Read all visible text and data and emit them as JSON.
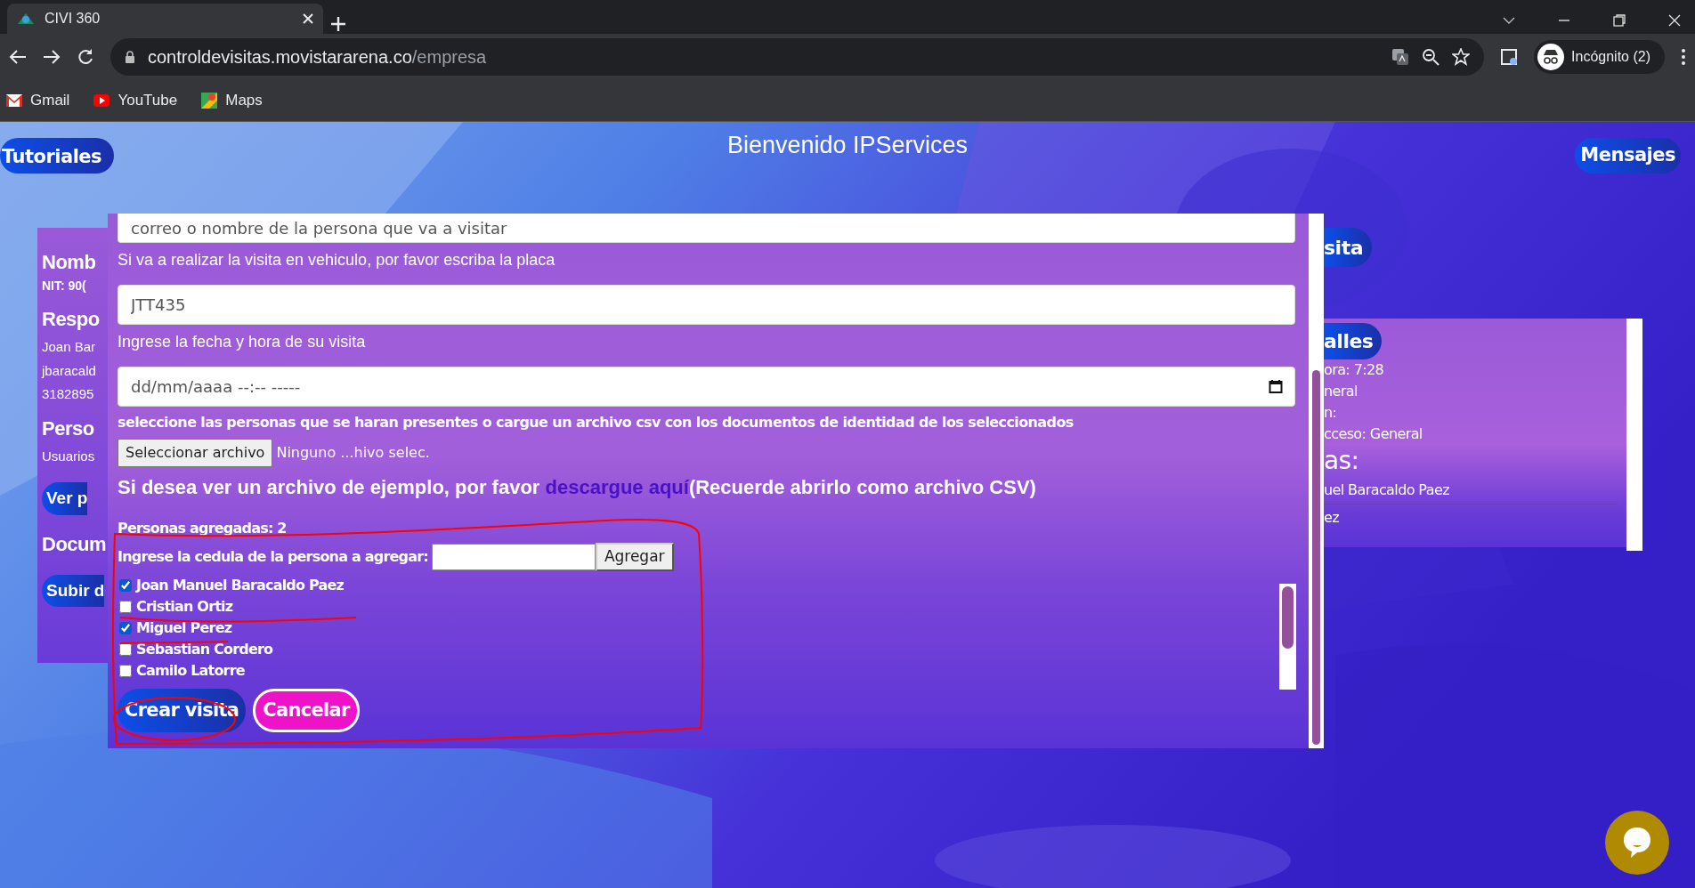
{
  "browser": {
    "tab_title": "CIVI 360",
    "url_host": "controldevisitas.movistararena.co",
    "url_path": "/empresa",
    "profile": "Incógnito (2)",
    "bookmarks": [
      {
        "label": "Gmail",
        "kind": "mail"
      },
      {
        "label": "YouTube",
        "kind": "video"
      },
      {
        "label": "Maps",
        "kind": "map"
      }
    ]
  },
  "header": {
    "tutorials_button": "Tutoriales",
    "title": "Bienvenido IPServices",
    "messages_button": "Mensajes"
  },
  "company_card": {
    "lines": [
      {
        "kind": "heading",
        "text": "Nomb"
      },
      {
        "kind": "sub",
        "text": "NIT: 90("
      },
      {
        "kind": "heading",
        "text": "Respo"
      },
      {
        "kind": "text",
        "text": "Joan Bar"
      },
      {
        "kind": "text",
        "text": "jbaracald"
      },
      {
        "kind": "text",
        "text": "3182895"
      },
      {
        "kind": "heading",
        "text": "Perso"
      },
      {
        "kind": "text",
        "text": "Usuarios"
      },
      {
        "kind": "button",
        "text": "Ver p"
      },
      {
        "kind": "heading",
        "text": "Docum"
      },
      {
        "kind": "button",
        "text": "Subir d"
      }
    ]
  },
  "visit_button": "sita",
  "details_card": {
    "button": "alles",
    "lines": [
      {
        "kind": "text",
        "text": "ora: 7:28"
      },
      {
        "kind": "text",
        "text": "neral"
      },
      {
        "kind": "text",
        "text": "n:"
      },
      {
        "kind": "text",
        "text": "cceso: General"
      },
      {
        "kind": "heading",
        "text": "as:"
      },
      {
        "kind": "item",
        "text": "uel Baracaldo Paez"
      },
      {
        "kind": "item",
        "text": "ez"
      }
    ]
  },
  "modal": {
    "host_field": {
      "placeholder": "correo o nombre de la persona que va a visitar"
    },
    "plate_label": "Si va a realizar la visita en vehiculo, por favor escriba la placa",
    "plate_field": {
      "value": "JTT435"
    },
    "date_label": "Ingrese la fecha y hora de su visita",
    "date_field": {
      "placeholder": "dd/mm/aaaa --:-- -----"
    },
    "people_label": "seleccione las personas que se haran presentes o cargue un archivo csv con los documentos de identidad de los seleccionados",
    "file_button": "Seleccionar archivo",
    "file_status": "Ninguno ...hivo selec.",
    "example_text": "Si desea ver un archivo de ejemplo, por favor ",
    "example_link": "descargue aquí",
    "example_note": "(Recuerde abrirlo como archivo CSV)",
    "added_count": "Personas agregadas: 2",
    "id_label": "Ingrese la cedula de la persona a agregar:",
    "add_button": "Agregar",
    "people": [
      {
        "name": "Joan Manuel Baracaldo Paez",
        "checked": true
      },
      {
        "name": "Cristian Ortiz",
        "checked": false
      },
      {
        "name": "Miguel Perez",
        "checked": true
      },
      {
        "name": "Sebastian Cordero",
        "checked": false
      },
      {
        "name": "Camilo Latorre",
        "checked": false
      }
    ],
    "buttons": [
      {
        "label": "Crear visita",
        "kind": "primary"
      },
      {
        "label": "Cancelar",
        "kind": "danger"
      }
    ]
  }
}
